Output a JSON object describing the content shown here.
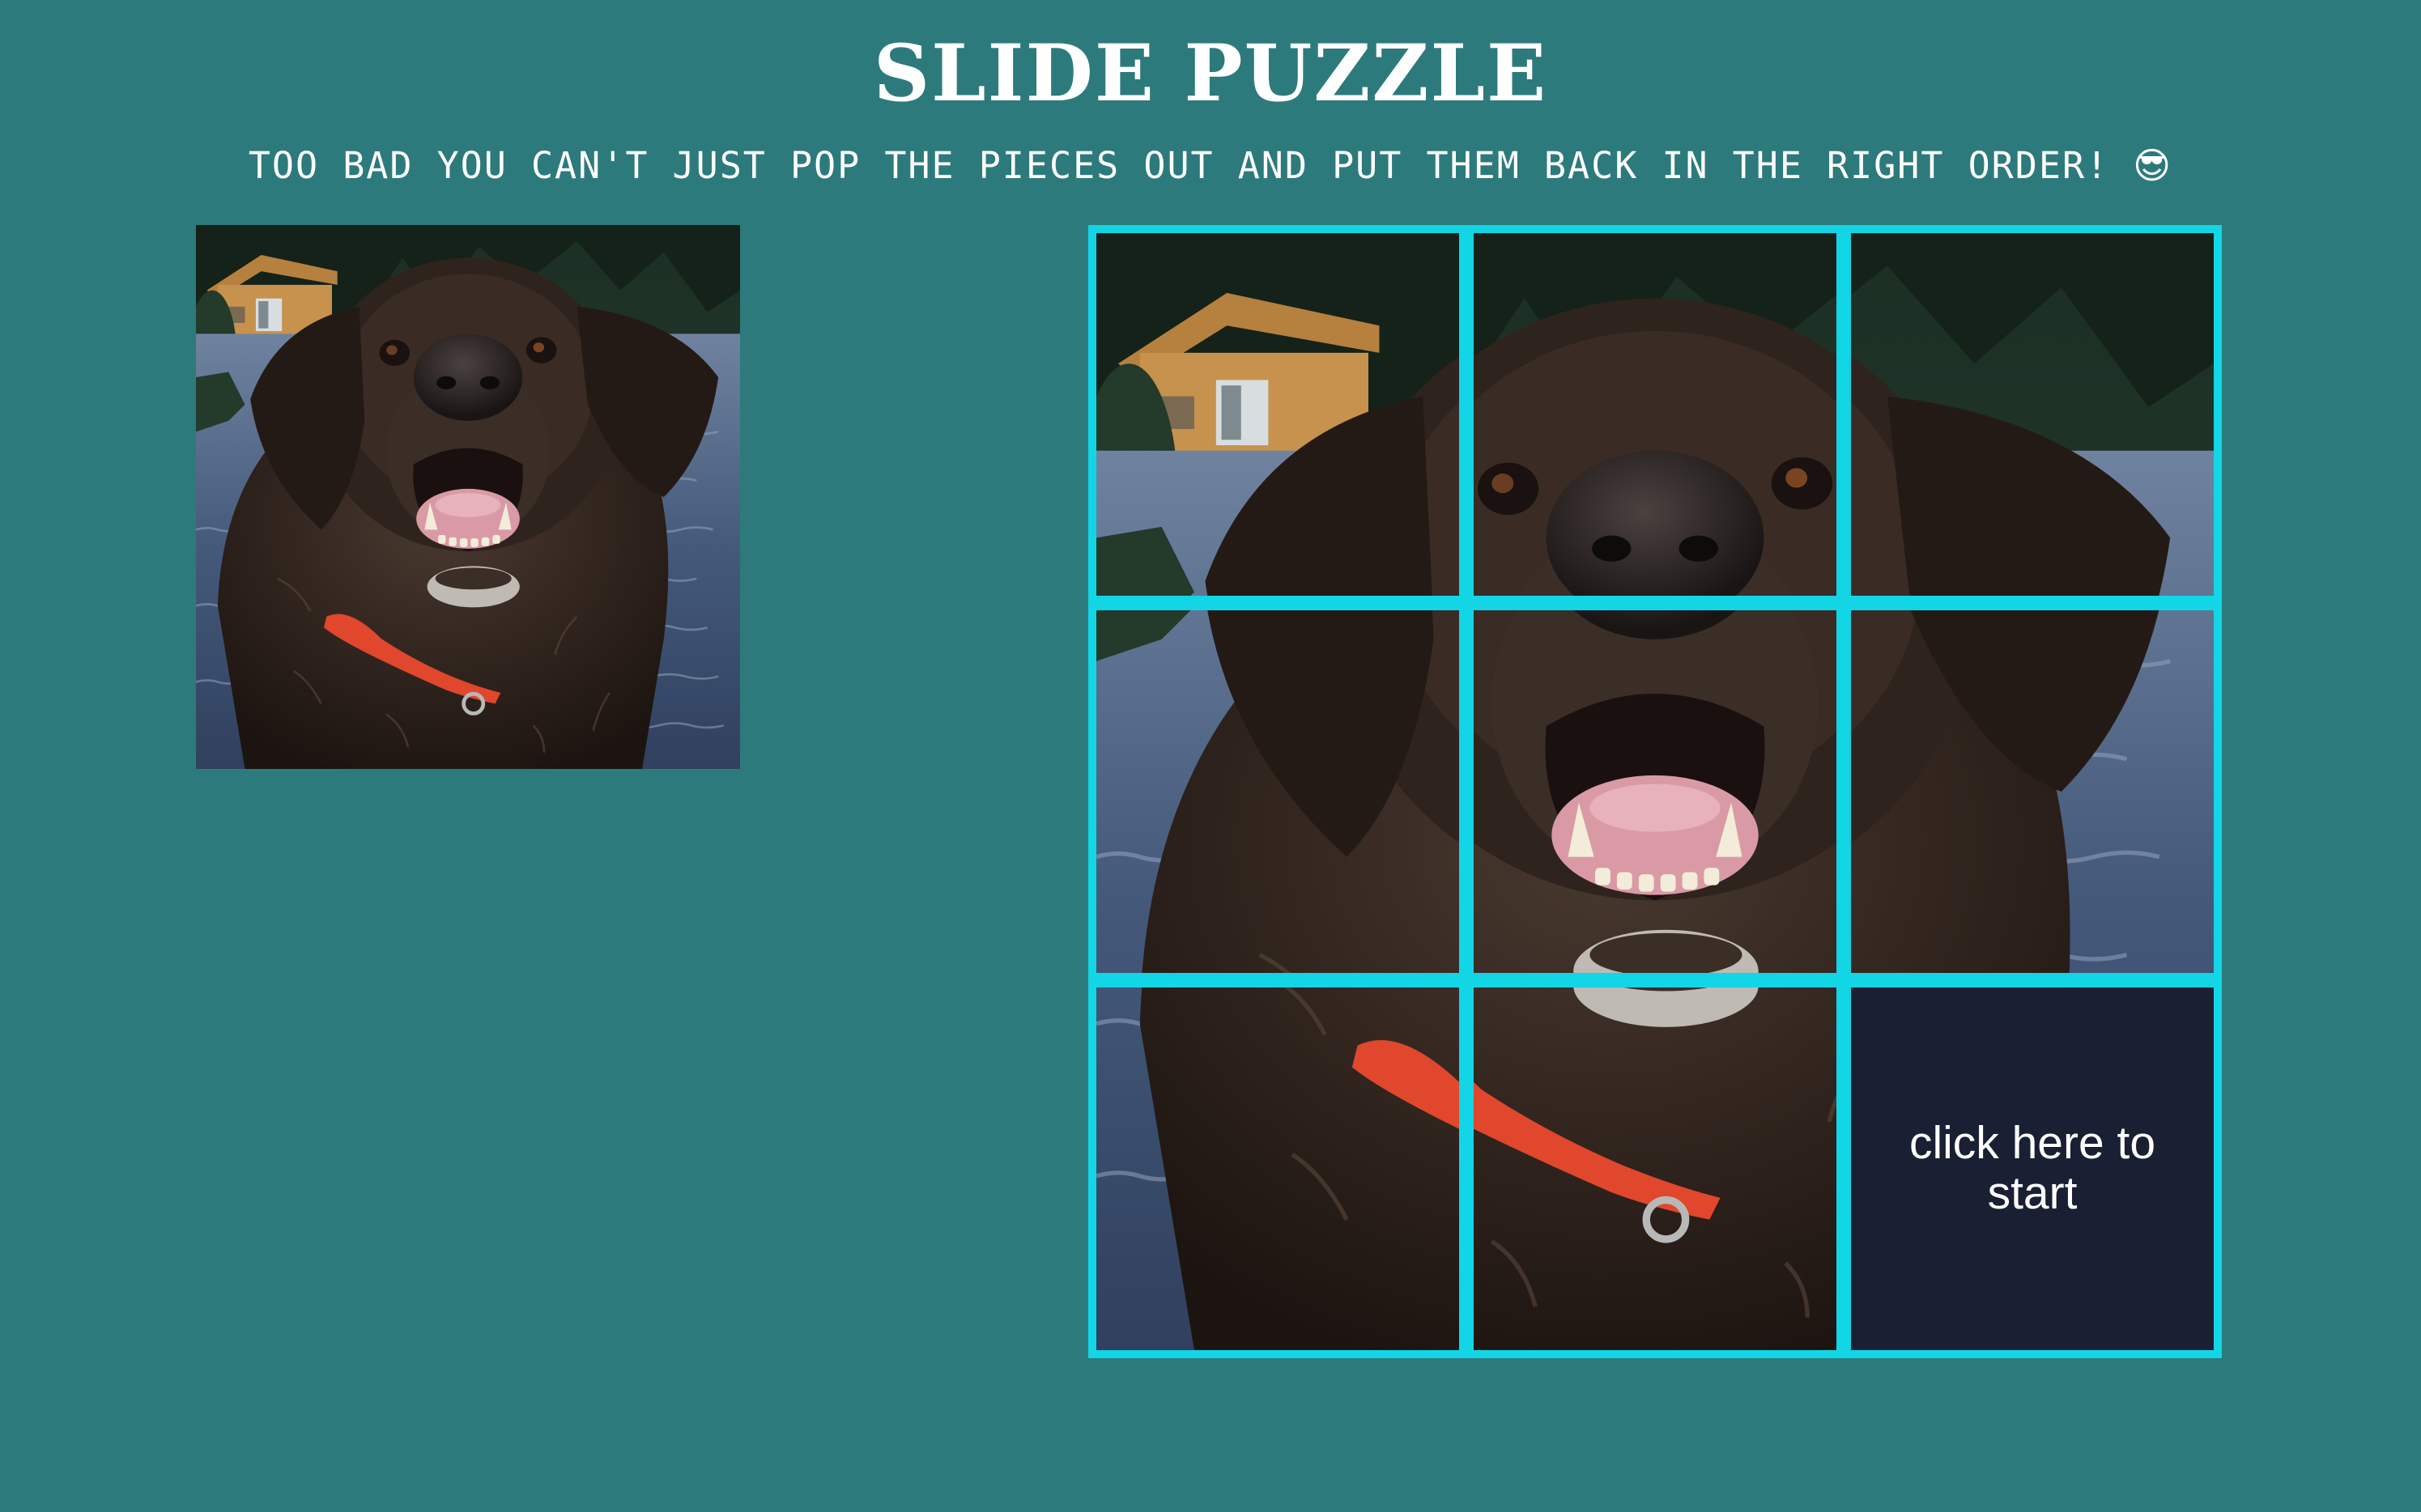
{
  "header": {
    "title": "SLIDE PUZZLE",
    "subtitle": "TOO BAD YOU CAN'T JUST POP THE PIECES OUT AND PUT THEM BACK IN THE RIGHT ORDER!",
    "subtitle_emoji": "😎"
  },
  "reference_image": {
    "subject": "dog-in-lake-photo"
  },
  "puzzle": {
    "grid_size": 3,
    "empty_tile_label": "click here to start",
    "tiles": [
      {
        "piece": 1
      },
      {
        "piece": 2
      },
      {
        "piece": 3
      },
      {
        "piece": 4
      },
      {
        "piece": 5
      },
      {
        "piece": 6
      },
      {
        "piece": 7
      },
      {
        "piece": 8
      },
      {
        "piece": null
      }
    ]
  },
  "colors": {
    "background": "#2d7a7c",
    "board_border": "#12d5e6",
    "empty_tile": "#1a2033",
    "text": "#ffffff",
    "dog_fur": "#2f231d",
    "collar": "#e0472c",
    "water": "#4d607e",
    "trees": "#1f3327"
  }
}
